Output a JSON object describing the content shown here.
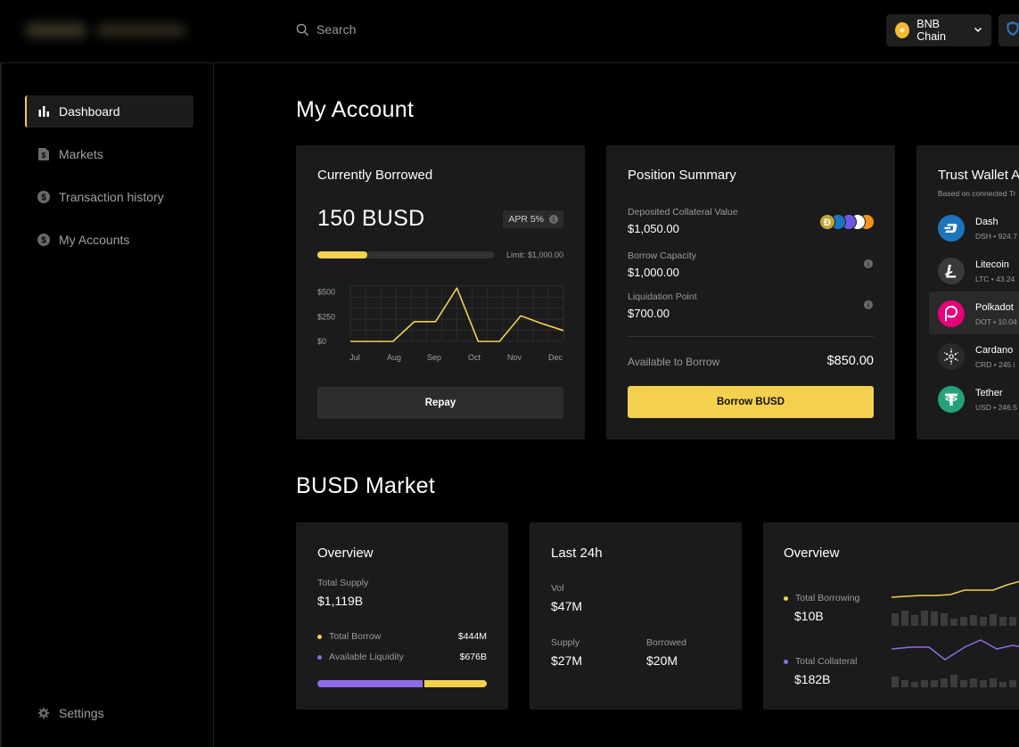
{
  "header": {
    "search_placeholder": "Search",
    "chain_label": "BNB Chain"
  },
  "sidebar": {
    "items": [
      {
        "label": "Dashboard",
        "icon": "bar-chart-icon"
      },
      {
        "label": "Markets",
        "icon": "document-icon"
      },
      {
        "label": "Transaction history",
        "icon": "dollar-circle-icon"
      },
      {
        "label": "My Accounts",
        "icon": "dollar-circle-icon"
      }
    ],
    "settings_label": "Settings"
  },
  "my_account": {
    "title": "My Account",
    "borrowed": {
      "title": "Currently Borrowed",
      "amount": "150 BUSD",
      "apr": "APR 5%",
      "limit": "Limit: $1,000.00",
      "progress_fraction": 0.15,
      "repay_label": "Repay"
    },
    "position": {
      "title": "Position Summary",
      "collateral_label": "Deposited Collateral Value",
      "collateral_value": "$1,050.00",
      "capacity_label": "Borrow Capacity",
      "capacity_value": "$1,000.00",
      "liquidation_label": "Liquidation Point",
      "liquidation_value": "$700.00",
      "available_label": "Available to Borrow",
      "available_value": "$850.00",
      "borrow_label": "Borrow BUSD"
    },
    "wallet": {
      "title": "Trust Wallet A",
      "subtitle": "Based on connected Tr",
      "assets": [
        {
          "name": "Dash",
          "detail": "DSH • 924.7",
          "color": "#1c75bc"
        },
        {
          "name": "Litecoin",
          "detail": "LTC • 43.24",
          "color": "#3a3a3a"
        },
        {
          "name": "Polkadot",
          "detail": "DOT • 10.04",
          "color": "#e6007a"
        },
        {
          "name": "Cardano",
          "detail": "CRD • 245 i",
          "color": "#2a2a2a"
        },
        {
          "name": "Tether",
          "detail": "USD • 246.5",
          "color": "#26a17b"
        }
      ]
    }
  },
  "busd_market": {
    "title": "BUSD Market",
    "overview": {
      "title": "Overview",
      "total_supply_label": "Total Supply",
      "total_supply_value": "$1,119B",
      "total_borrow_label": "Total Borrow",
      "total_borrow_value": "$444M",
      "available_liquidity_label": "Available Liquidity",
      "available_liquidity_value": "$676B",
      "borrow_share": 0.62
    },
    "last24": {
      "title": "Last 24h",
      "vol_label": "Vol",
      "vol_value": "$47M",
      "supply_label": "Supply",
      "supply_value": "$27M",
      "borrowed_label": "Borrowed",
      "borrowed_value": "$20M"
    },
    "overview2": {
      "title": "Overview",
      "total_borrowing_label": "Total Borrowing",
      "total_borrowing_value": "$10B",
      "total_collateral_label": "Total Collateral",
      "total_collateral_value": "$182B"
    }
  },
  "colors": {
    "accent_yellow": "#f4d04f",
    "accent_purple": "#8f6bea",
    "card_bg": "#1b1b1b"
  },
  "chart_data": {
    "type": "line",
    "categories": [
      "Jul",
      "Aug",
      "Sep",
      "Oct",
      "Nov",
      "Dec"
    ],
    "x": [
      0,
      1,
      2,
      3,
      4,
      5,
      6,
      7,
      8,
      9,
      10
    ],
    "values": [
      0,
      0,
      0,
      200,
      200,
      540,
      0,
      0,
      260,
      180,
      110
    ],
    "ytick_labels": [
      "$500",
      "$250",
      "$0"
    ],
    "ylim": [
      0,
      560
    ],
    "grid": true,
    "color": "#f4d04f"
  }
}
